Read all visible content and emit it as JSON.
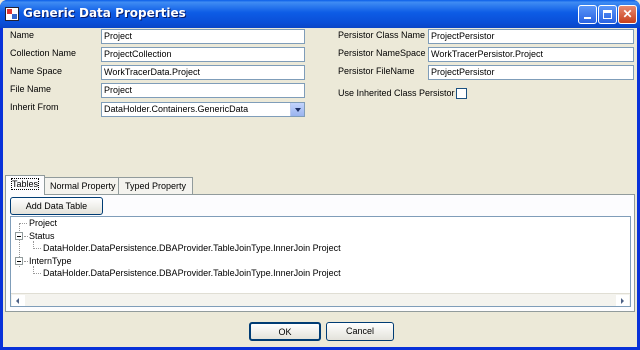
{
  "window": {
    "title": "Generic Data Properties"
  },
  "fields_left": [
    {
      "label": "Name",
      "value": "Project"
    },
    {
      "label": "Collection Name",
      "value": "ProjectCollection"
    },
    {
      "label": "Name Space",
      "value": "WorkTracerData.Project"
    },
    {
      "label": "File Name",
      "value": "Project"
    }
  ],
  "inherit_from": {
    "label": "Inherit From",
    "value": "DataHolder.Containers.GenericData"
  },
  "fields_right": [
    {
      "label": "Persistor Class Name",
      "value": "ProjectPersistor"
    },
    {
      "label": "Persistor NameSpace",
      "value": "WorkTracerPersistor.Project"
    },
    {
      "label": "Persistor FileName",
      "value": "ProjectPersistor"
    }
  ],
  "use_inherited": {
    "label": "Use Inherited Class Persistor",
    "checked": false
  },
  "tabs": [
    {
      "label": "Tables",
      "active": true
    },
    {
      "label": "Normal Property",
      "active": false
    },
    {
      "label": "Typed Property",
      "active": false
    }
  ],
  "add_button": "Add Data Table",
  "tree": {
    "root": "Project",
    "items": [
      {
        "label": "Status",
        "child": "DataHolder.DataPersistence.DBAProvider.TableJoinType.InnerJoin  Project"
      },
      {
        "label": "InternType",
        "child": "DataHolder.DataPersistence.DBAProvider.TableJoinType.InnerJoin  Project"
      }
    ]
  },
  "footer": {
    "ok": "OK",
    "cancel": "Cancel"
  },
  "icons": {
    "minimize": "minimize-icon",
    "maximize": "maximize-icon",
    "close": "close-icon"
  }
}
